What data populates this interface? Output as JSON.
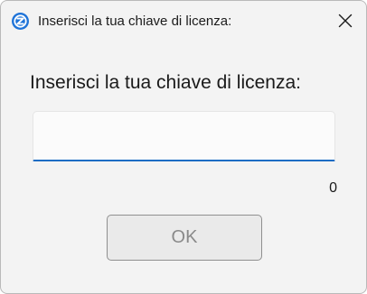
{
  "window": {
    "title": "Inserisci la tua chiave di licenza:",
    "app_icon": "app-logo-icon",
    "close_icon": "close-icon"
  },
  "dialog": {
    "prompt": "Inserisci la tua chiave di licenza:",
    "license_input": {
      "value": "",
      "placeholder": ""
    },
    "char_count": "0",
    "ok_label": "OK"
  },
  "colors": {
    "accent": "#1c6cc4",
    "window_bg": "#f3f3f3",
    "button_text_disabled": "#8a8a8a"
  }
}
